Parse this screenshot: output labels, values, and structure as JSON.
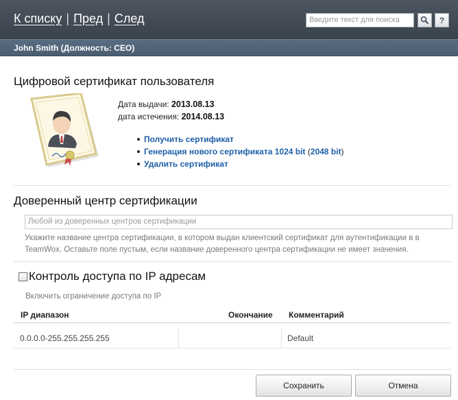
{
  "nav": {
    "back_to_list": "К списку",
    "prev": "Пред",
    "next": "След",
    "separator": "|"
  },
  "search": {
    "placeholder": "Введите текст для поиска",
    "search_icon": "magnifier-icon",
    "help_label": "?"
  },
  "user": {
    "name_title": "John Smith (Должность: CEO)"
  },
  "certificate": {
    "heading": "Цифровой сертификат пользователя",
    "issue_label": "Дата выдачи:",
    "issue_date": "2013.08.13",
    "expire_label": "дата истечения:",
    "expire_date": "2014.08.13",
    "links": {
      "get": "Получить сертификат",
      "generate": "Генерация нового сертификата 1024 bit",
      "paren_open": "(",
      "generate_2048": "2048 bit",
      "paren_close": ")",
      "delete": "Удалить сертификат"
    }
  },
  "trusted_ca": {
    "heading": "Доверенный центр сертификации",
    "placeholder": "Любой из доверенных центров сертификации",
    "hint": "Укажите название центра сертификации, в котором выдан клиентский сертификат для аутентификации в в TeamWox. Оставьте поле пустым, если название доверенного центра сертификации не имеет значения."
  },
  "ip_control": {
    "label": "Контроль доступа по IP адресам",
    "checked": false,
    "hint": "Включить ограничение доступа по IP",
    "columns": {
      "range": "IP диапазон",
      "end": "Окончание",
      "comment": "Комментарий"
    },
    "rows": [
      {
        "range": "0.0.0.0-255.255.255.255",
        "end": "",
        "comment": "Default"
      }
    ]
  },
  "buttons": {
    "save": "Сохранить",
    "cancel": "Отмена"
  }
}
